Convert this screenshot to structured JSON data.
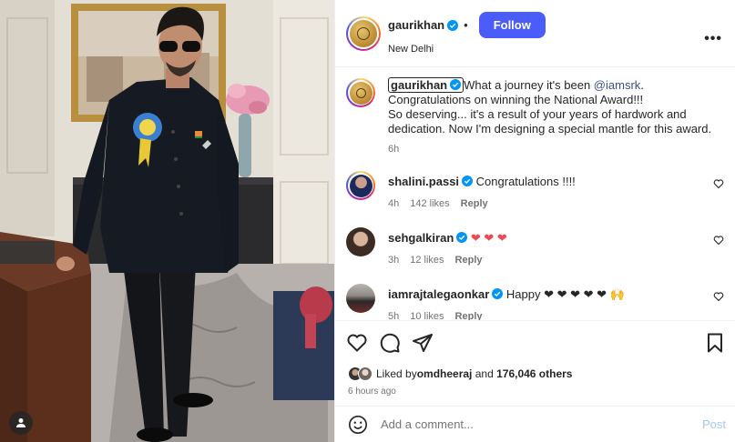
{
  "header": {
    "username": "gaurikhan",
    "dot": "•",
    "follow_label": "Follow",
    "location": "New Delhi",
    "more": "•••"
  },
  "caption": {
    "username": "gaurikhan",
    "pre_mention": "What a journey it's been ",
    "mention": "@iamsrk",
    "line1_rest": ". Congratulations on winning the National Award!!!",
    "line2": "So deserving... it's a result of your years of hardwork and dedication. Now I'm designing a special mantle for this award.",
    "time": "6h"
  },
  "comments": [
    {
      "username": "shalini.passi",
      "text": "Congratulations !!!!",
      "time": "4h",
      "likes": "142 likes",
      "reply": "Reply"
    },
    {
      "username": "sehgalkiran",
      "text": "❤ ❤ ❤",
      "time": "3h",
      "likes": "12 likes",
      "reply": "Reply"
    },
    {
      "username": "iamrajtalegaonkar",
      "text": "Happy ❤ ❤ ❤ ❤ ❤ 🙌",
      "time": "5h",
      "likes": "10 likes",
      "reply": "Reply"
    }
  ],
  "likes": {
    "prefix": "Liked by ",
    "user": "omdheeraj",
    "middle": " and ",
    "count": "176,046 others"
  },
  "posted": "6 hours ago",
  "add_comment": {
    "placeholder": "Add a comment...",
    "post_label": "Post"
  },
  "icons": {
    "heart": "heart-icon",
    "comment": "comment-icon",
    "share": "share-icon",
    "save": "bookmark-icon",
    "emoji": "emoji-icon",
    "user_tag": "user-tag-icon",
    "verified": "verified-badge-icon"
  },
  "colors": {
    "follow_button": "#4a5df9",
    "verified": "#0095f6",
    "mention": "#385185",
    "post_disabled": "#a5c4f5"
  }
}
